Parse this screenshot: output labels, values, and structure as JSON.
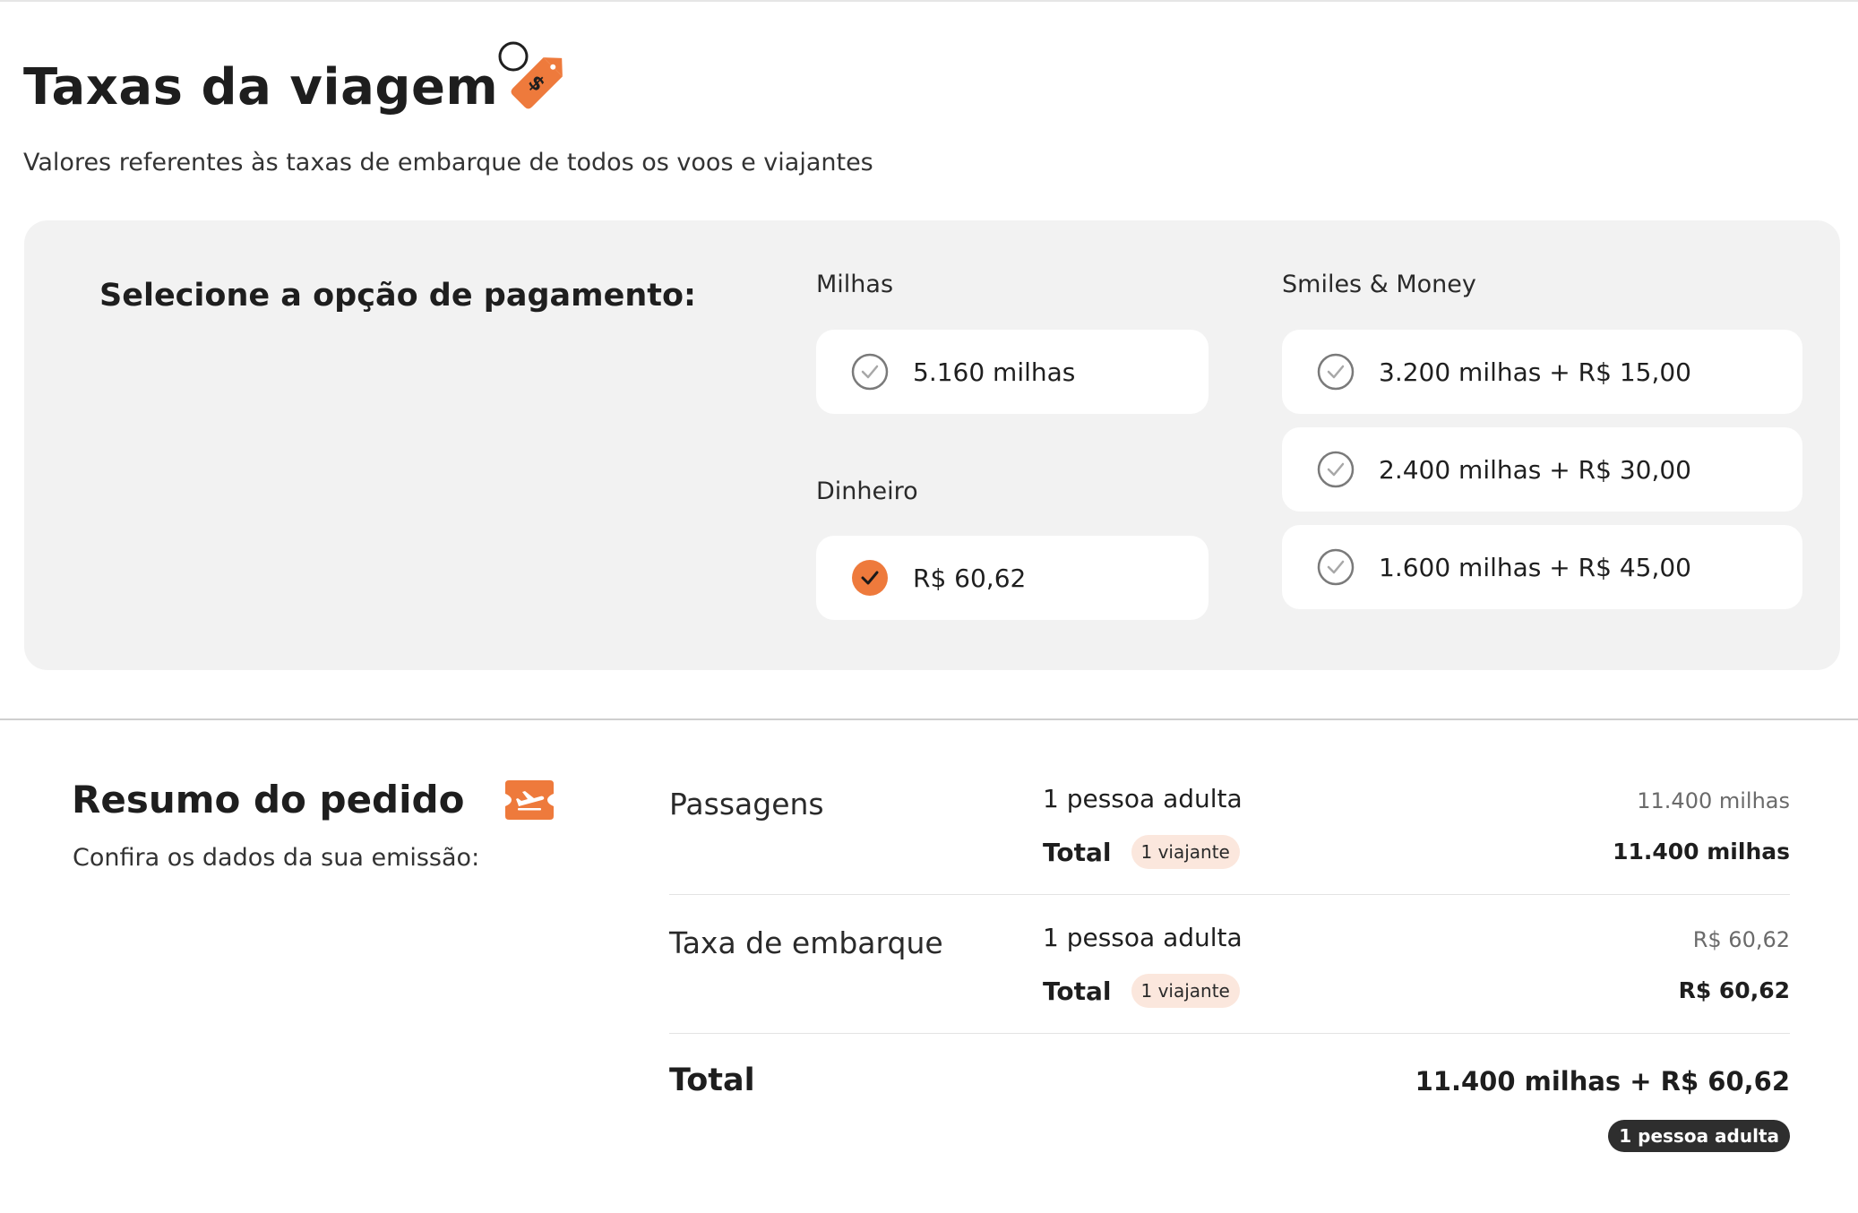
{
  "header": {
    "title": "Taxas da viagem",
    "subtitle": "Valores referentes às taxas de embarque de todos os voos e viajantes",
    "title_icon": "price-tag-icon"
  },
  "payment": {
    "heading": "Selecione a opção de pagamento:",
    "groups": {
      "milhas": {
        "label": "Milhas",
        "options": [
          {
            "label": "5.160 milhas",
            "selected": false
          }
        ]
      },
      "dinheiro": {
        "label": "Dinheiro",
        "options": [
          {
            "label": "R$ 60,62",
            "selected": true
          }
        ]
      },
      "smiles_money": {
        "label": "Smiles & Money",
        "options": [
          {
            "label": "3.200 milhas + R$ 15,00",
            "selected": false
          },
          {
            "label": "2.400 milhas + R$ 30,00",
            "selected": false
          },
          {
            "label": "1.600 milhas + R$ 45,00",
            "selected": false
          }
        ]
      }
    }
  },
  "summary": {
    "title": "Resumo do pedido",
    "title_icon": "plane-ticket-icon",
    "subtitle": "Confira os dados da sua emissão:",
    "sections": [
      {
        "label": "Passagens",
        "pax": "1 pessoa adulta",
        "amount": "11.400 milhas",
        "total_label": "Total",
        "badge": "1 viajante",
        "total_amount": "11.400 milhas"
      },
      {
        "label": "Taxa de embarque",
        "pax": "1 pessoa adulta",
        "amount": "R$ 60,62",
        "total_label": "Total",
        "badge": "1 viajante",
        "total_amount": "R$ 60,62"
      }
    ],
    "grand_total": {
      "label": "Total",
      "amount": "11.400 milhas + R$ 60,62",
      "badge": "1 pessoa adulta"
    }
  },
  "colors": {
    "accent": "#ee7a3c",
    "panel": "#f2f2f2",
    "badge_light": "#fbe7dd",
    "badge_dark": "#2e2e2e"
  }
}
